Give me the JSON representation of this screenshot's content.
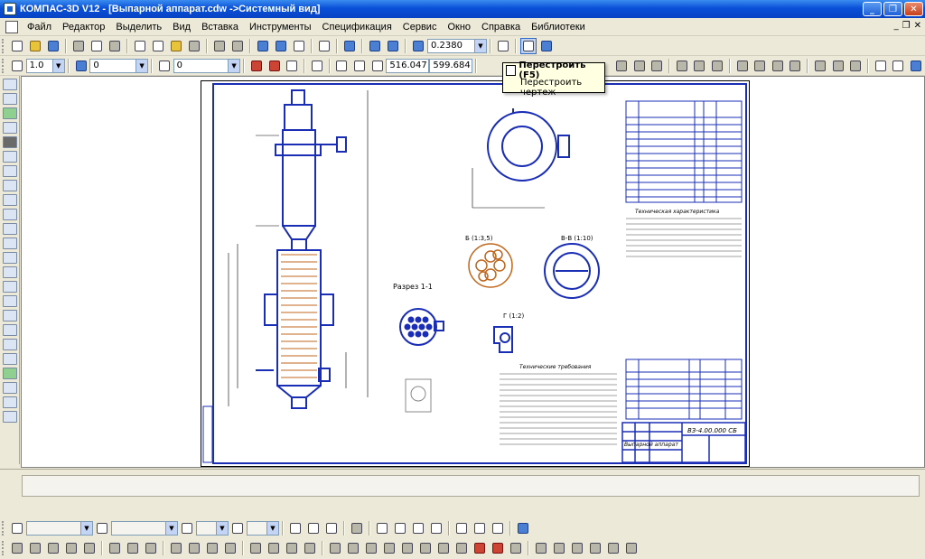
{
  "window": {
    "title": "КОМПАС-3D V12 - [Выпарной аппарат.cdw ->Системный вид]",
    "minimize": "_",
    "restore": "❐",
    "close": "✕"
  },
  "menu": {
    "items": [
      "Файл",
      "Редактор",
      "Выделить",
      "Вид",
      "Вставка",
      "Инструменты",
      "Спецификация",
      "Сервис",
      "Окно",
      "Справка",
      "Библиотеки"
    ],
    "mdi_min": "_",
    "mdi_restore": "❐",
    "mdi_close": "✕"
  },
  "toolbar1": {
    "zoom_value": "0.2380"
  },
  "toolbar2": {
    "line_width": "1.0",
    "layer_value": "0",
    "style_value": "0",
    "coord_x": "516.047",
    "coord_y": "599.684"
  },
  "tooltip": {
    "title": "Перестроить (F5)",
    "description": "Перестроить чертеж"
  },
  "drawing": {
    "section_label": "Разрез 1-1",
    "view_b_label": "Б (1:3,5)",
    "view_vv_label": "В-В (1:10)",
    "view_g_label": "Г (1:2)",
    "tech_spec_title": "Техническая характеристика",
    "tech_req_title": "Технические требования",
    "doc_code": "ВЗ-4.00.000 СБ",
    "doc_name": "Выпарной аппарат"
  },
  "icons": {
    "new": "new-file-icon",
    "open": "open-folder-icon",
    "save": "save-icon",
    "print": "print-icon",
    "cut": "scissors-icon",
    "copy": "copy-icon",
    "paste": "paste-icon",
    "undo": "undo-icon",
    "redo": "redo-icon",
    "rebuild": "rebuild-icon",
    "zoom_in": "zoom-in-icon",
    "zoom_out": "zoom-out-icon",
    "pan": "pan-icon"
  }
}
